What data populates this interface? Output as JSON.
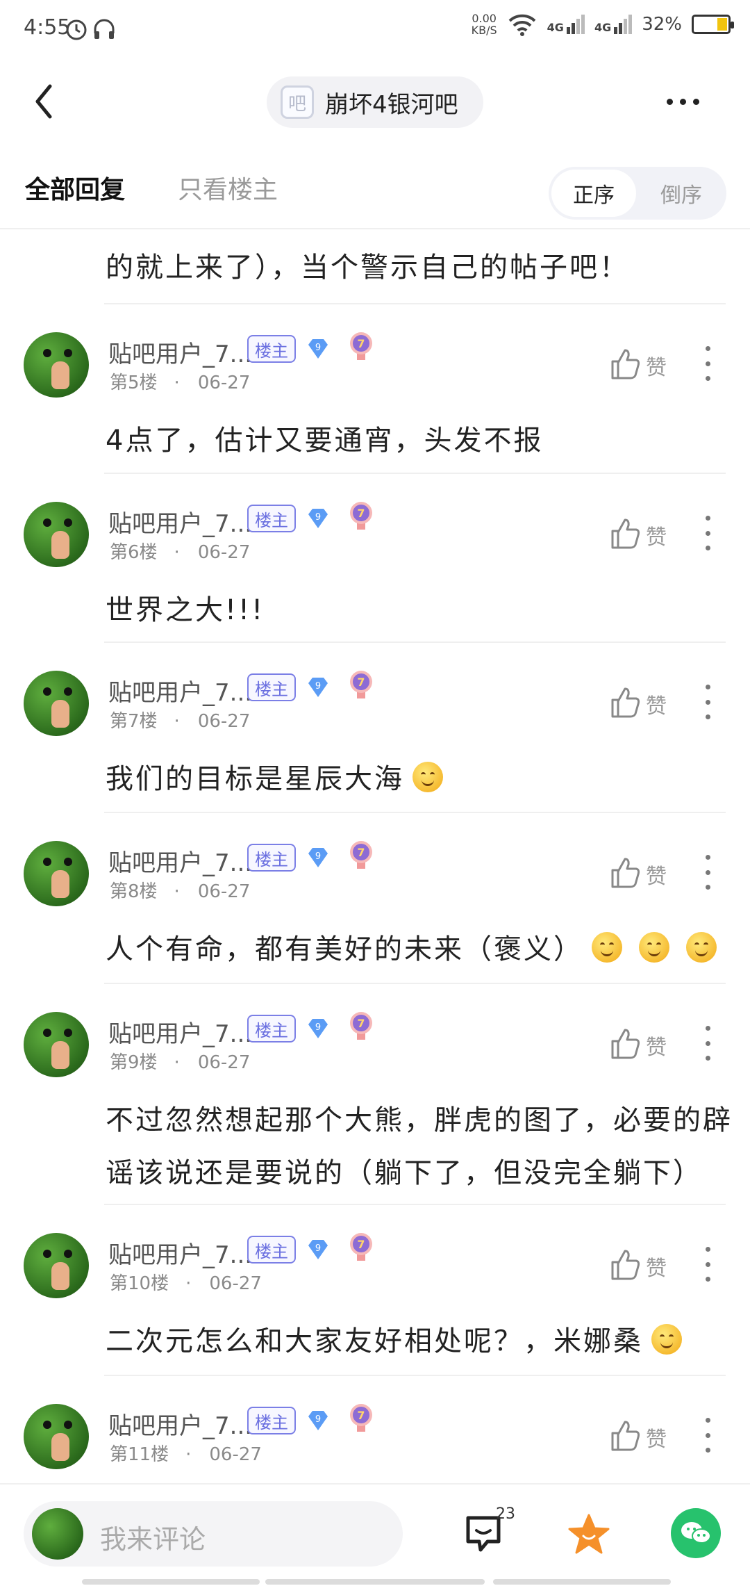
{
  "status_bar": {
    "time": "4:55",
    "speed": "0.00",
    "speed_unit": "KB/S",
    "net1": "4G",
    "net2": "4G",
    "battery": "32%"
  },
  "header": {
    "forum_icon_char": "吧",
    "forum_name": "崩坏4银河吧"
  },
  "tabs": {
    "all_replies": "全部回复",
    "host_only": "只看楼主",
    "order_asc": "正序",
    "order_desc": "倒序"
  },
  "fragment_text": "的就上来了），当个警示自己的帖子吧！",
  "posts": [
    {
      "username": "贴吧用户_7...",
      "badge": "楼主",
      "level": "9",
      "floor": "第5楼",
      "date": "06-27",
      "like_label": "赞",
      "text": "4点了，估计又要通宵，头发不报",
      "text2": ""
    },
    {
      "username": "贴吧用户_7...",
      "badge": "楼主",
      "level": "9",
      "floor": "第6楼",
      "date": "06-27",
      "like_label": "赞",
      "text": "世界之大!!!",
      "text2": ""
    },
    {
      "username": "贴吧用户_7...",
      "badge": "楼主",
      "level": "9",
      "floor": "第7楼",
      "date": "06-27",
      "like_label": "赞",
      "text": "我们的目标是星辰大海",
      "text2": ""
    },
    {
      "username": "贴吧用户_7...",
      "badge": "楼主",
      "level": "9",
      "floor": "第8楼",
      "date": "06-27",
      "like_label": "赞",
      "text": "人个有命，都有美好的未来（褒义）",
      "text2": ""
    },
    {
      "username": "贴吧用户_7...",
      "badge": "楼主",
      "level": "9",
      "floor": "第9楼",
      "date": "06-27",
      "like_label": "赞",
      "text": "不过忽然想起那个大熊，胖虎的图了，必要的辟",
      "text2": "谣该说还是要说的（躺下了，但没完全躺下）"
    },
    {
      "username": "贴吧用户_7...",
      "badge": "楼主",
      "level": "9",
      "floor": "第10楼",
      "date": "06-27",
      "like_label": "赞",
      "text": "二次元怎么和大家友好相处呢？，米娜桑",
      "text2": ""
    },
    {
      "username": "贴吧用户_7...",
      "badge": "楼主",
      "level": "9",
      "floor": "第11楼",
      "date": "06-27",
      "like_label": "赞",
      "text": "",
      "text2": ""
    }
  ],
  "medal_char": "7",
  "bottom_bar": {
    "comment_placeholder": "我来评论",
    "reply_count": "23"
  },
  "icons": [
    "back-icon",
    "more-icon",
    "like-icon",
    "reply-icon",
    "star-icon",
    "wechat-icon"
  ],
  "colors": {
    "accent_purple": "#6a6fe0",
    "star_orange": "#f5902a",
    "wechat_green": "#27c26d",
    "level_blue": "#5b9cf5"
  }
}
